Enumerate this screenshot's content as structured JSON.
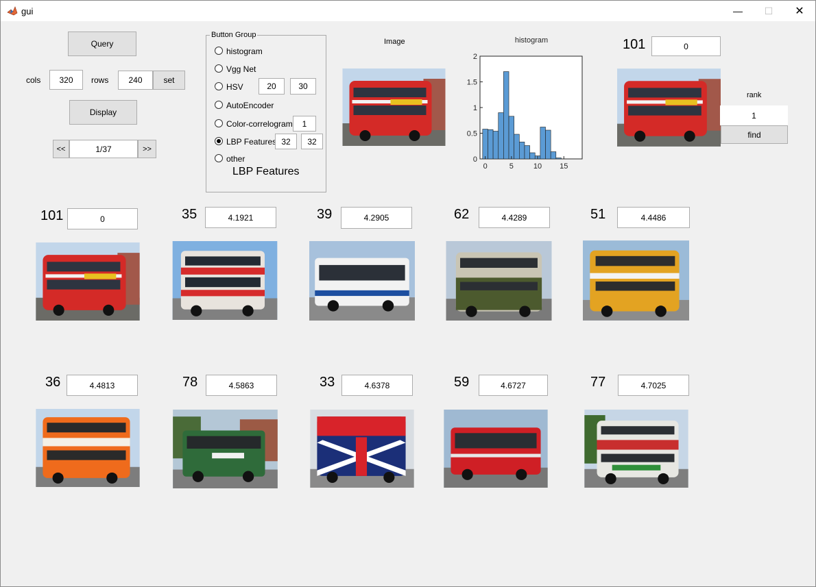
{
  "window": {
    "title": "gui",
    "minimize": "—",
    "maximize": "☐",
    "close": "✕"
  },
  "controls": {
    "query_label": "Query",
    "cols_label": "cols",
    "cols_value": "320",
    "rows_label": "rows",
    "rows_value": "240",
    "set_label": "set",
    "display_label": "Display",
    "prev_label": "<<",
    "page_value": "1/37",
    "next_label": ">>"
  },
  "button_group": {
    "title": "Button Group",
    "options": [
      {
        "label": "histogram",
        "selected": false
      },
      {
        "label": "Vgg Net",
        "selected": false
      },
      {
        "label": "HSV",
        "selected": false,
        "params": [
          "20",
          "30"
        ]
      },
      {
        "label": "AutoEncoder",
        "selected": false
      },
      {
        "label": "Color-correlogram",
        "selected": false,
        "params": [
          "1"
        ]
      },
      {
        "label": "LBP Features",
        "selected": true,
        "params": [
          "32",
          "32"
        ]
      },
      {
        "label": "other",
        "selected": false
      }
    ],
    "current_method": "LBP Features"
  },
  "query_image": {
    "label": "Image"
  },
  "top_match": {
    "index": "101",
    "score": "0"
  },
  "rank": {
    "label": "rank",
    "value": "1",
    "find_label": "find"
  },
  "results": [
    {
      "index": "101",
      "score": "0"
    },
    {
      "index": "35",
      "score": "4.1921"
    },
    {
      "index": "39",
      "score": "4.2905"
    },
    {
      "index": "62",
      "score": "4.4289"
    },
    {
      "index": "51",
      "score": "4.4486"
    },
    {
      "index": "36",
      "score": "4.4813"
    },
    {
      "index": "78",
      "score": "4.5863"
    },
    {
      "index": "33",
      "score": "4.6378"
    },
    {
      "index": "59",
      "score": "4.6727"
    },
    {
      "index": "77",
      "score": "4.7025"
    }
  ],
  "colors": {
    "bar_fill": "#5b9bd5",
    "bar_edge": "#1f1f1f"
  },
  "chart_data": {
    "type": "bar",
    "title": "histogram",
    "xlabel": "",
    "ylabel": "",
    "xlim": [
      -0.5,
      19
    ],
    "ylim": [
      0,
      2
    ],
    "x_ticks": [
      "0",
      "5",
      "10",
      "15"
    ],
    "y_ticks": [
      "0",
      "0.5",
      "1",
      "1.5",
      "2"
    ],
    "categories": [
      0,
      1,
      2,
      3,
      4,
      5,
      6,
      7,
      8,
      9,
      10,
      11,
      12,
      13,
      14,
      15
    ],
    "values": [
      0.58,
      0.57,
      0.54,
      0.9,
      1.7,
      0.83,
      0.48,
      0.33,
      0.26,
      0.12,
      0.06,
      0.62,
      0.56,
      0.14,
      0.02,
      0.0
    ]
  }
}
